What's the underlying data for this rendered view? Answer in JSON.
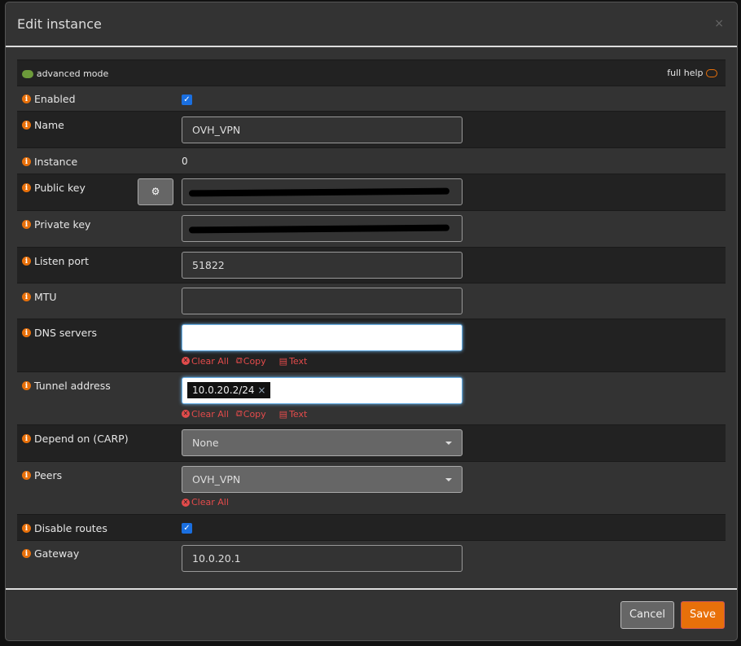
{
  "modal": {
    "title": "Edit instance",
    "close": "×"
  },
  "toolbar": {
    "advanced_mode": "advanced mode",
    "full_help": "full help"
  },
  "fields": {
    "enabled": {
      "label": "Enabled",
      "checked": true
    },
    "name": {
      "label": "Name",
      "value": "OVH_VPN"
    },
    "instance": {
      "label": "Instance",
      "value": "0"
    },
    "public_key": {
      "label": "Public key",
      "value": "[redacted]"
    },
    "private_key": {
      "label": "Private key",
      "value": "[redacted]"
    },
    "listen_port": {
      "label": "Listen port",
      "value": "51822"
    },
    "mtu": {
      "label": "MTU",
      "value": ""
    },
    "dns_servers": {
      "label": "DNS servers",
      "value": ""
    },
    "tunnel_address": {
      "label": "Tunnel address",
      "tags": [
        "10.0.20.2/24"
      ]
    },
    "depend_on": {
      "label": "Depend on (CARP)",
      "value": "None"
    },
    "peers": {
      "label": "Peers",
      "value": "OVH_VPN"
    },
    "disable_routes": {
      "label": "Disable routes",
      "checked": true
    },
    "gateway": {
      "label": "Gateway",
      "value": "10.0.20.1"
    }
  },
  "actions": {
    "clear_all": "Clear All",
    "copy": "Copy",
    "text": "Text"
  },
  "footer": {
    "cancel": "Cancel",
    "save": "Save"
  },
  "colors": {
    "accent": "#e8700a",
    "checkbox": "#1a6fe0",
    "danger": "#e34b4b"
  }
}
